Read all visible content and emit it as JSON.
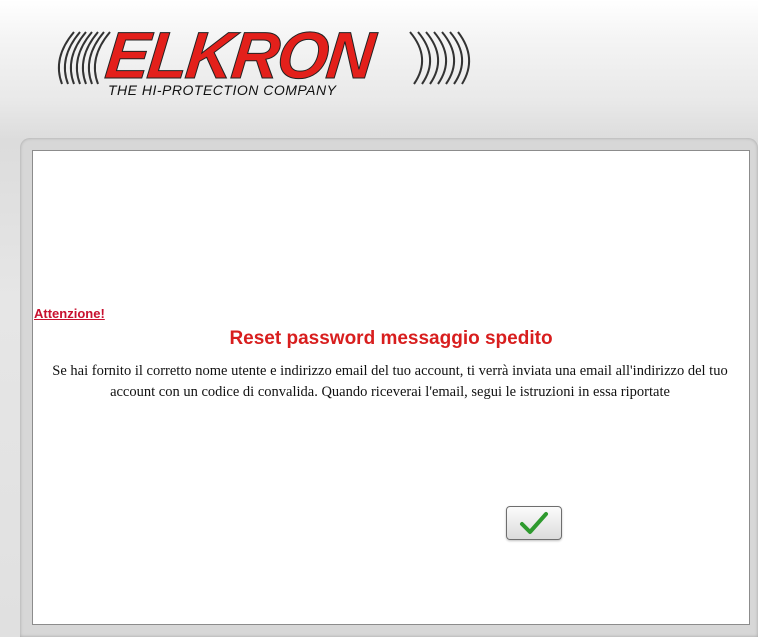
{
  "header": {
    "logo_text": "ELKRON",
    "tagline": "THE HI-PROTECTION COMPANY"
  },
  "dialog": {
    "attention_label": "Attenzione!",
    "title": "Reset password messaggio spedito",
    "message": "Se hai fornito il corretto nome utente e indirizzo email del tuo account, ti verrà inviata una email all'indirizzo del tuo account con un codice di convalida. Quando riceverai l'email, segui le istruzioni in essa riportate",
    "ok_button_icon": "checkmark-icon"
  },
  "colors": {
    "brand_red": "#e3201b",
    "title_red": "#d81e1e",
    "attention_red": "#c8102e",
    "check_green": "#2e9a2e"
  }
}
